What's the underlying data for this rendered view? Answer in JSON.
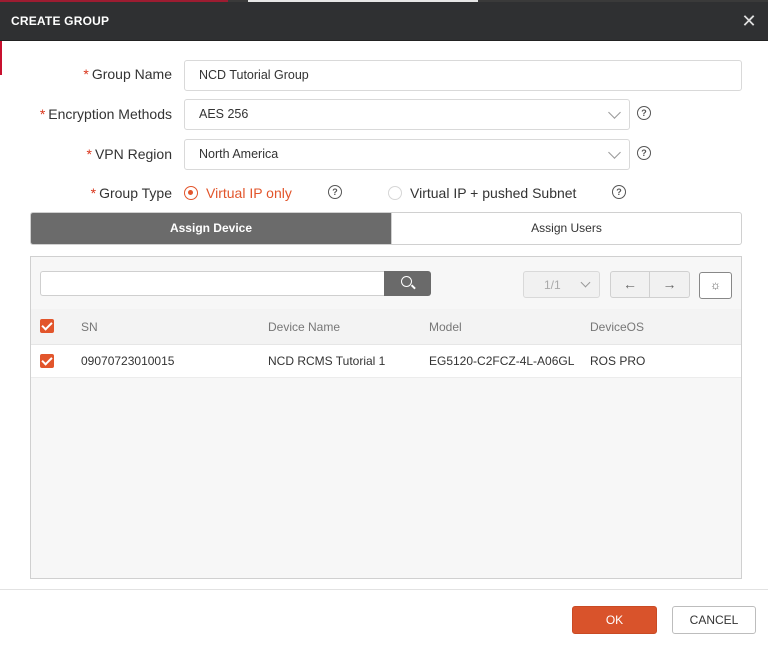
{
  "dialog": {
    "title": "CREATE GROUP",
    "close_icon": "close-icon",
    "accent_color": "#e2552b"
  },
  "form": {
    "required_mark": "*",
    "group_name": {
      "label": "Group Name",
      "value": "NCD Tutorial Group"
    },
    "encryption": {
      "label": "Encryption Methods",
      "value": "AES 256"
    },
    "vpn_region": {
      "label": "VPN Region",
      "value": "North America"
    },
    "group_type": {
      "label": "Group Type",
      "options": [
        {
          "label": "Virtual IP only",
          "selected": true
        },
        {
          "label": "Virtual IP + pushed Subnet",
          "selected": false
        }
      ]
    },
    "help_glyph": "?"
  },
  "tabs": [
    {
      "label": "Assign Device",
      "active": true
    },
    {
      "label": "Assign Users",
      "active": false
    }
  ],
  "toolbar": {
    "search_value": "",
    "search_icon": "search-icon",
    "page_indicator": "1/1",
    "prev_glyph": "←",
    "next_glyph": "→",
    "settings_glyph": "☼"
  },
  "table": {
    "columns": [
      "SN",
      "Device Name",
      "Model",
      "DeviceOS"
    ],
    "header_checked": true,
    "rows": [
      {
        "checked": true,
        "sn": "09070723010015",
        "device_name": "NCD RCMS Tutorial 1",
        "model": "EG5120-C2FCZ-4L-A06GL",
        "device_os": "ROS PRO"
      }
    ]
  },
  "footer": {
    "ok_label": "OK",
    "cancel_label": "CANCEL"
  }
}
